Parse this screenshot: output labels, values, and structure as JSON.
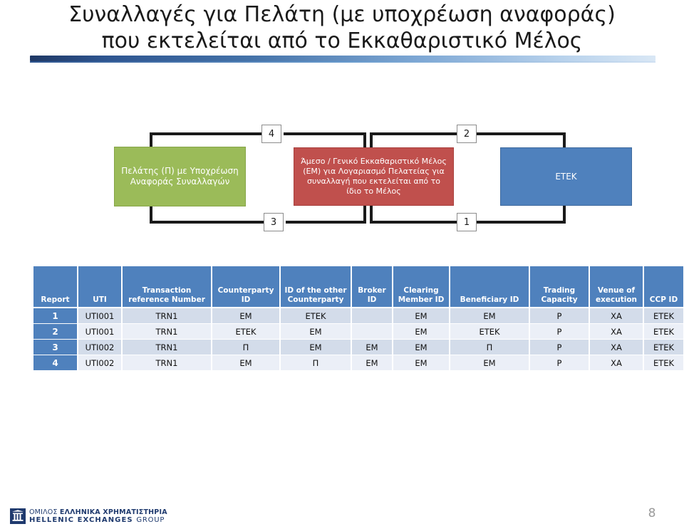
{
  "slide": {
    "title_line_1": "Συναλλαγές για Πελάτη (με υποχρέωση αναφοράς)",
    "title_line_2": "που εκτελείται από το Εκκαθαριστικό Μέλος",
    "page_number": "8"
  },
  "diagram": {
    "nodes": [
      {
        "id": "client",
        "label": "Πελάτης (Π) με Υποχρέωση Αναφοράς Συναλλαγών",
        "color": "#9BBB59"
      },
      {
        "id": "member",
        "label": "Άμεσο / Γενικό Εκκαθαριστικό Μέλος (ΕΜ) για Λογαριασμό Πελατείας για συναλλαγή που εκτελείται από το ίδιο το Μέλος",
        "color": "#C0504D"
      },
      {
        "id": "etek",
        "label": "ΕΤΕΚ",
        "color": "#4F81BD"
      }
    ],
    "connector_labels": {
      "top_left": "4",
      "top_right": "2",
      "bottom_left": "3",
      "bottom_right": "1"
    }
  },
  "table": {
    "headers": [
      "Report",
      "UTI",
      "Transaction reference Number",
      "Counterparty ID",
      "ID of the other Counterparty",
      "Broker ID",
      "Clearing Member ID",
      "Beneficiary ID",
      "Trading Capacity",
      "Venue of execution",
      "CCP ID"
    ],
    "rows": [
      {
        "report": "1",
        "uti": "UTI001",
        "trn": "TRN1",
        "counterparty_id": "ΕΜ",
        "other_counterparty": "ΕΤΕΚ",
        "broker_id": "",
        "clearing_member_id": "ΕΜ",
        "beneficiary_id": "ΕΜ",
        "trading_capacity": "P",
        "venue_of_execution": "ΧΑ",
        "ccp_id": "ΕΤΕΚ"
      },
      {
        "report": "2",
        "uti": "UTI001",
        "trn": "TRN1",
        "counterparty_id": "ΕΤΕΚ",
        "other_counterparty": "ΕΜ",
        "broker_id": "",
        "clearing_member_id": "ΕΜ",
        "beneficiary_id": "ΕΤΕΚ",
        "trading_capacity": "P",
        "venue_of_execution": "ΧΑ",
        "ccp_id": "ΕΤΕΚ"
      },
      {
        "report": "3",
        "uti": "UTI002",
        "trn": "TRN1",
        "counterparty_id": "Π",
        "other_counterparty": "ΕΜ",
        "broker_id": "ΕΜ",
        "clearing_member_id": "ΕΜ",
        "beneficiary_id": "Π",
        "trading_capacity": "P",
        "venue_of_execution": "ΧΑ",
        "ccp_id": "ΕΤΕΚ"
      },
      {
        "report": "4",
        "uti": "UTI002",
        "trn": "TRN1",
        "counterparty_id": "ΕΜ",
        "other_counterparty": "Π",
        "broker_id": "ΕΜ",
        "clearing_member_id": "ΕΜ",
        "beneficiary_id": "ΕΜ",
        "trading_capacity": "P",
        "venue_of_execution": "ΧΑ",
        "ccp_id": "ΕΤΕΚ"
      }
    ]
  },
  "footer": {
    "logo_line_1_plain": "ΟΜΙΛΟΣ ",
    "logo_line_1_bold": "ΕΛΛΗΝΙΚΑ ΧΡΗΜΑΤΙΣΤΗΡΙΑ",
    "logo_line_2_bold": "HELLENIC EXCHANGES ",
    "logo_line_2_plain": "GROUP"
  },
  "colors": {
    "green": "#9BBB59",
    "red": "#C0504D",
    "blue": "#4F81BD",
    "header_blue": "#4F81BD",
    "row_odd": "#D3DCEA",
    "row_even": "#EBEFF7",
    "brand_navy": "#1F3A6E"
  }
}
